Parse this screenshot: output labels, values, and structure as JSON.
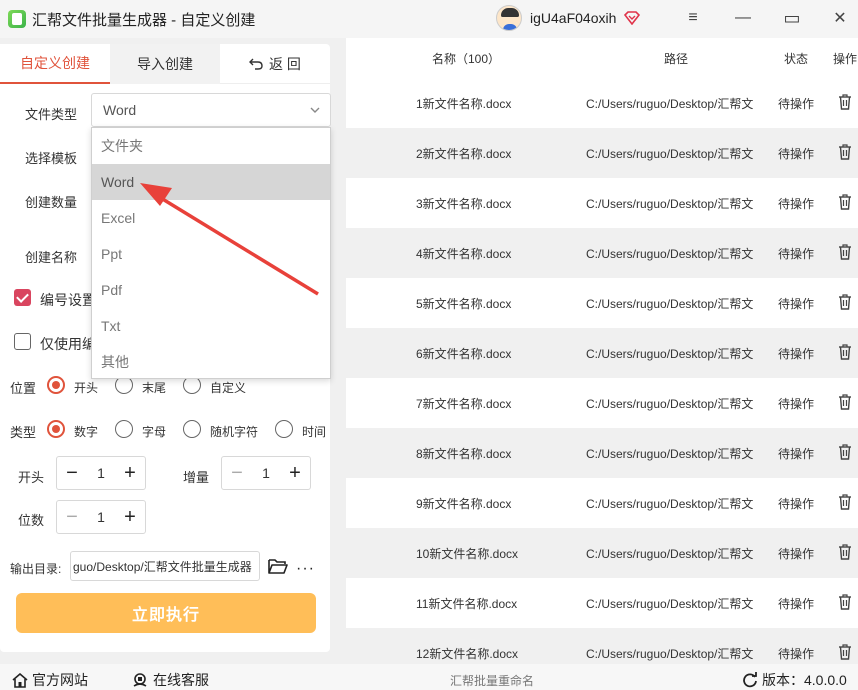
{
  "titlebar": {
    "title": "汇帮文件批量生成器 - 自定义创建",
    "username": "igU4aF04oxih",
    "minimize_glyph": "≡",
    "menu_glyph": "—",
    "maximize_glyph": "▭",
    "close_glyph": "✕"
  },
  "tabs": [
    {
      "label": "自定义创建"
    },
    {
      "label": "导入创建"
    },
    {
      "label": "返 回",
      "icon": "undo-icon"
    }
  ],
  "form": {
    "file_type_label": "文件类型",
    "file_type_value": "Word",
    "template_label": "选择模板",
    "count_label": "创建数量",
    "name_label": "创建名称",
    "numbering_label": "编号设置",
    "only_label": "仅使用编",
    "position_label": "位置",
    "position_options": [
      "开头",
      "末尾",
      "自定义"
    ],
    "type_label": "类型",
    "type_options": [
      "数字",
      "字母",
      "随机字符",
      "时间"
    ],
    "start_label": "开头",
    "start_value": "1",
    "increment_label": "增量",
    "increment_value": "1",
    "digits_label": "位数",
    "digits_value": "1",
    "output_label": "输出目录:",
    "output_value": "guo/Desktop/汇帮文件批量生成器",
    "more_glyph": "···",
    "run_label": "立即执行"
  },
  "dropdown": {
    "options": [
      "文件夹",
      "Word",
      "Excel",
      "Ppt",
      "Pdf",
      "Txt",
      "其他"
    ],
    "selected": "Word"
  },
  "table": {
    "headers": {
      "name": "名称（100）",
      "path": "路径",
      "status": "状态",
      "action": "操作"
    },
    "rows": [
      {
        "name": "1新文件名称.docx",
        "path": "C:/Users/ruguo/Desktop/汇帮文",
        "status": "待操作"
      },
      {
        "name": "2新文件名称.docx",
        "path": "C:/Users/ruguo/Desktop/汇帮文",
        "status": "待操作"
      },
      {
        "name": "3新文件名称.docx",
        "path": "C:/Users/ruguo/Desktop/汇帮文",
        "status": "待操作"
      },
      {
        "name": "4新文件名称.docx",
        "path": "C:/Users/ruguo/Desktop/汇帮文",
        "status": "待操作"
      },
      {
        "name": "5新文件名称.docx",
        "path": "C:/Users/ruguo/Desktop/汇帮文",
        "status": "待操作"
      },
      {
        "name": "6新文件名称.docx",
        "path": "C:/Users/ruguo/Desktop/汇帮文",
        "status": "待操作"
      },
      {
        "name": "7新文件名称.docx",
        "path": "C:/Users/ruguo/Desktop/汇帮文",
        "status": "待操作"
      },
      {
        "name": "8新文件名称.docx",
        "path": "C:/Users/ruguo/Desktop/汇帮文",
        "status": "待操作"
      },
      {
        "name": "9新文件名称.docx",
        "path": "C:/Users/ruguo/Desktop/汇帮文",
        "status": "待操作"
      },
      {
        "name": "10新文件名称.docx",
        "path": "C:/Users/ruguo/Desktop/汇帮文",
        "status": "待操作"
      },
      {
        "name": "11新文件名称.docx",
        "path": "C:/Users/ruguo/Desktop/汇帮文",
        "status": "待操作"
      },
      {
        "name": "12新文件名称.docx",
        "path": "C:/Users/ruguo/Desktop/汇帮文",
        "status": "待操作"
      }
    ]
  },
  "footer": {
    "website": "官方网站",
    "support": "在线客服",
    "center": "汇帮批量重命名",
    "version": "版本：4.0.0.0"
  },
  "colors": {
    "accent": "#e0533b",
    "run_button": "#ffbe58",
    "arrow": "#e8413a"
  }
}
